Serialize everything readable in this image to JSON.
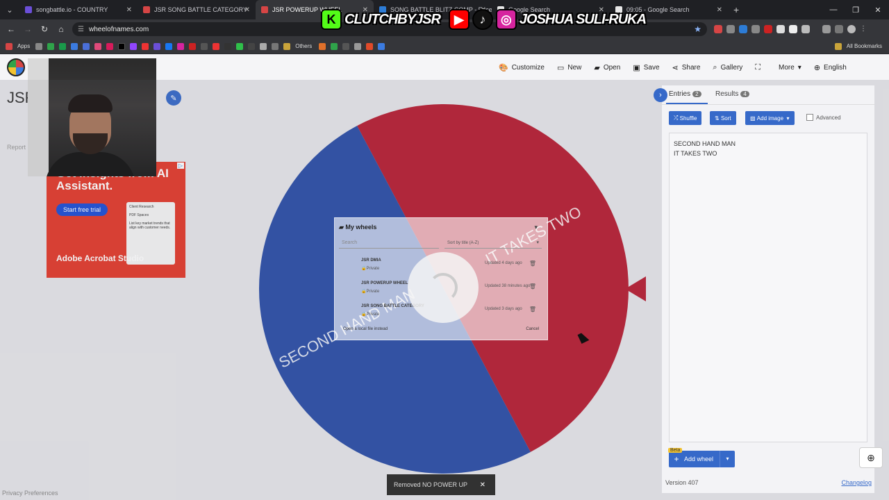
{
  "browser": {
    "tabs": [
      {
        "title": "songbattle.io - COUNTRY",
        "color": "#6b4fd8"
      },
      {
        "title": "JSR SONG BATTLE CATEGORY",
        "color": "#d64545"
      },
      {
        "title": "JSR POWERUP WHEEL",
        "color": "#d64545"
      },
      {
        "title": "SONG BATTLE BLITZ COMP - Excel",
        "color": "#2d7cd6"
      },
      {
        "title": "Google Search",
        "color": "#e8e8e8"
      },
      {
        "title": "09:05 - Google Search",
        "color": "#e8e8e8"
      }
    ],
    "url": "wheelofnames.com",
    "bookmarks_label_apps": "Apps",
    "bookmarks_label_others": "Others",
    "bookmarks_label_all": "All Bookmarks"
  },
  "streamer_overlay": {
    "handle1": "CLUTCHBYJSR",
    "handle2": "JOSHUA SULI-RUKA"
  },
  "header": {
    "customize": "Customize",
    "new": "New",
    "open": "Open",
    "save": "Save",
    "share": "Share",
    "gallery": "Gallery",
    "more": "More",
    "language": "English"
  },
  "left": {
    "title_fragment": "JSF",
    "report": "Report",
    "privacy": "Privacy Preferences"
  },
  "ad": {
    "headline": "Get insights from AI Assistant.",
    "cta": "Start free trial",
    "card_title": "Client Research",
    "card_item1": "PDF Spaces",
    "card_item2": "List key market trends that align with customer needs.",
    "brand": "Adobe Acrobat Studio",
    "badge": "▷"
  },
  "wheel": {
    "slices": [
      {
        "label": "IT TAKES TWO",
        "color": "#b71f34"
      },
      {
        "label": "SECOND HAND MAN",
        "color": "#2c4fa8"
      }
    ]
  },
  "dialog": {
    "title": "My wheels",
    "search_placeholder": "Search",
    "sort_label": "Sort by title (A-Z)",
    "rows": [
      {
        "name": "JSR DMIA",
        "privacy": "Private",
        "updated": "Updated 4 days ago"
      },
      {
        "name": "JSR POWERUP WHEEL",
        "privacy": "Private",
        "updated": "Updated 38 minutes ago"
      },
      {
        "name": "JSR SONG BATTLE CATEGORY",
        "privacy": "Private",
        "updated": "Updated 3 days ago"
      }
    ],
    "open_local": "Open a local file instead",
    "cancel": "Cancel"
  },
  "panel": {
    "tab_entries": "Entries",
    "entries_count": "2",
    "tab_results": "Results",
    "results_count": "4",
    "shuffle": "Shuffle",
    "sort": "Sort",
    "add_image": "Add image",
    "advanced": "Advanced",
    "entries": [
      "SECOND HAND MAN",
      "IT TAKES TWO"
    ],
    "beta": "Beta",
    "add_wheel": "Add wheel",
    "version": "Version 407",
    "changelog": "Changelog"
  },
  "toast": {
    "message": "Removed NO POWER UP"
  }
}
